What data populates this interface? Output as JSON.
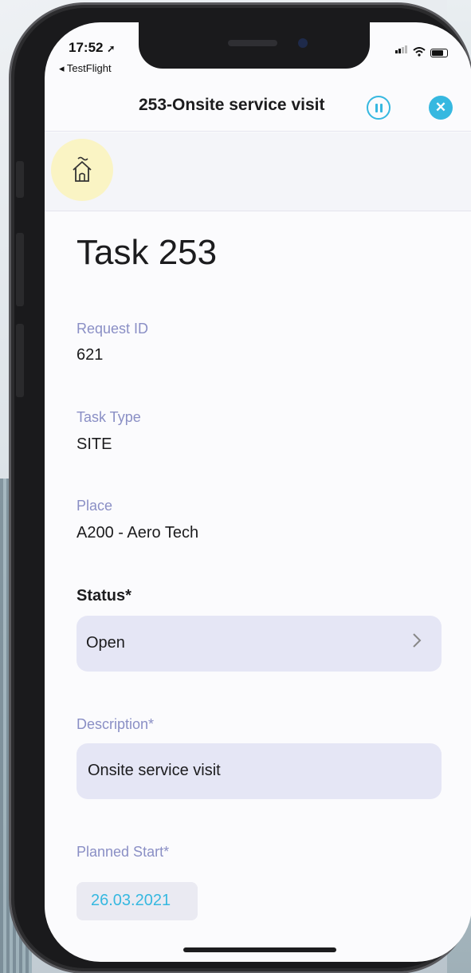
{
  "status_bar": {
    "time": "17:52",
    "back_app": "TestFlight"
  },
  "header": {
    "title": "253-Onsite service visit"
  },
  "page": {
    "title": "Task 253"
  },
  "fields": {
    "request_id_label": "Request ID",
    "request_id_value": "621",
    "task_type_label": "Task Type",
    "task_type_value": "SITE",
    "place_label": "Place",
    "place_value": "A200 - Aero Tech",
    "status_label": "Status*",
    "status_value": "Open",
    "description_label": "Description*",
    "description_value": "Onsite service visit",
    "planned_start_label": "Planned Start*",
    "planned_start_value": "26.03.2021"
  },
  "colors": {
    "accent": "#36b8e0",
    "label": "#8a8fc5",
    "field_bg": "#e5e6f5",
    "home_highlight": "#faf4c4"
  },
  "icons": [
    "location-arrow-icon",
    "signal-icon",
    "wifi-icon",
    "battery-icon",
    "pause-icon",
    "close-icon",
    "home-icon",
    "chevron-right-icon"
  ]
}
